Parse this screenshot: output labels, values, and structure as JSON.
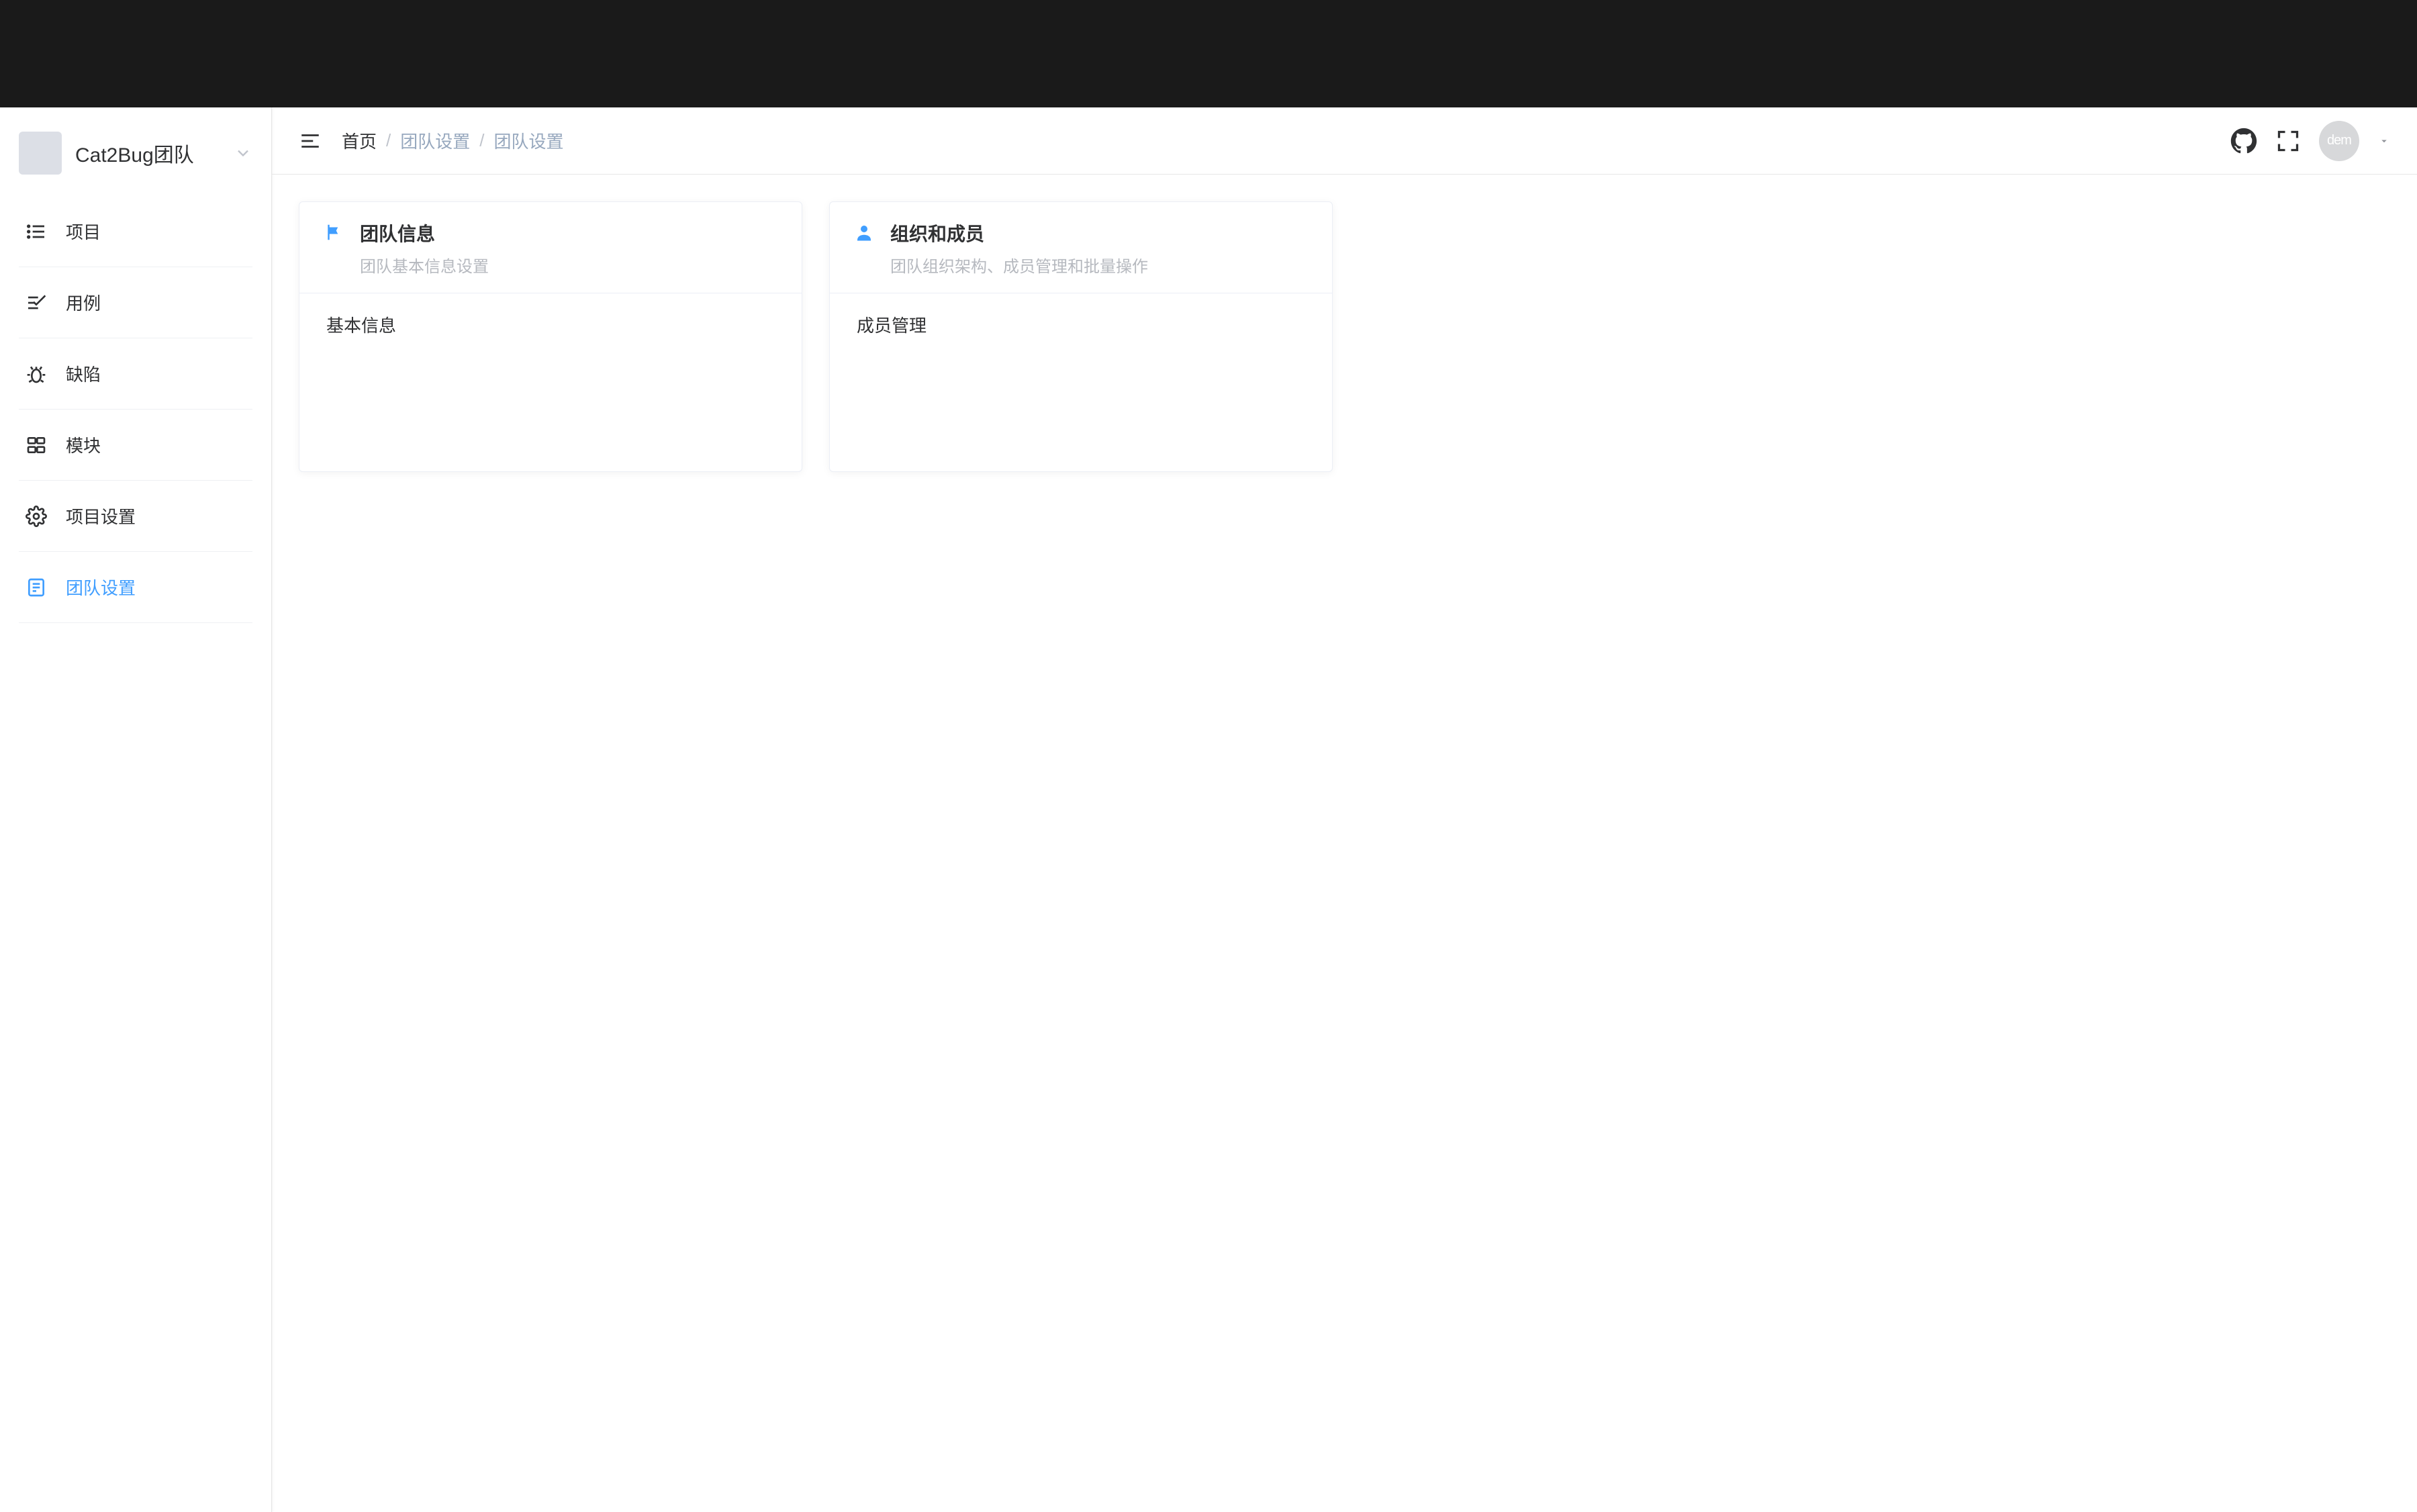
{
  "colors": {
    "primary": "#409eff"
  },
  "sidebar": {
    "team_name": "Cat2Bug团队",
    "items": [
      {
        "label": "项目",
        "icon": "list-icon"
      },
      {
        "label": "用例",
        "icon": "checklist-icon"
      },
      {
        "label": "缺陷",
        "icon": "bug-icon"
      },
      {
        "label": "模块",
        "icon": "module-icon"
      },
      {
        "label": "项目设置",
        "icon": "gear-icon"
      },
      {
        "label": "团队设置",
        "icon": "team-icon",
        "active": true
      }
    ]
  },
  "breadcrumb": {
    "items": [
      "首页",
      "团队设置",
      "团队设置"
    ]
  },
  "user": {
    "avatar_text": "dem"
  },
  "cards": [
    {
      "icon": "flag-icon",
      "title": "团队信息",
      "subtitle": "团队基本信息设置",
      "links": [
        {
          "label": "基本信息"
        }
      ]
    },
    {
      "icon": "person-icon",
      "title": "组织和成员",
      "subtitle": "团队组织架构、成员管理和批量操作",
      "links": [
        {
          "label": "成员管理"
        }
      ]
    }
  ]
}
